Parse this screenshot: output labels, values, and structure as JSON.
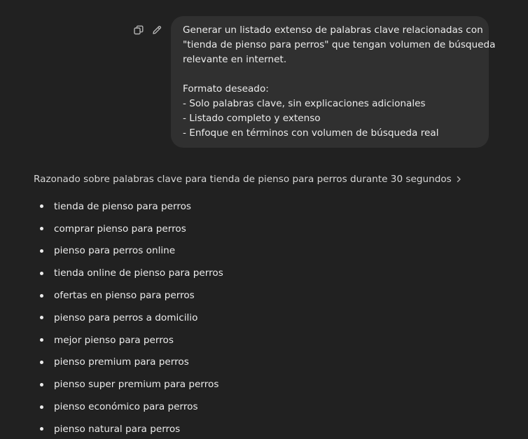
{
  "user_message": {
    "lines": [
      "Generar un listado extenso de palabras clave relacionadas con",
      "\"tienda de pienso para perros\" que tengan volumen de búsqueda",
      "relevante en internet.",
      "",
      "Formato deseado:",
      "- Solo palabras clave, sin explicaciones adicionales",
      "- Listado completo y extenso",
      "- Enfoque en términos con volumen de búsqueda real"
    ],
    "actions": [
      {
        "icon": "copy-icon"
      },
      {
        "icon": "pencil-icon"
      }
    ]
  },
  "reasoning": {
    "label": "Razonado sobre palabras clave para tienda de pienso para perros durante 30 segundos",
    "icon": "chevron-right-icon"
  },
  "keywords": [
    "tienda de pienso para perros",
    "comprar pienso para perros",
    "pienso para perros online",
    "tienda online de pienso para perros",
    "ofertas en pienso para perros",
    "pienso para perros a domicilio",
    "mejor pienso para perros",
    "pienso premium para perros",
    "pienso super premium para perros",
    "pienso económico para perros",
    "pienso natural para perros"
  ],
  "colors": {
    "background": "#212121",
    "bubble": "#303030",
    "text": "#ececec",
    "icon": "#b4b4b4"
  }
}
